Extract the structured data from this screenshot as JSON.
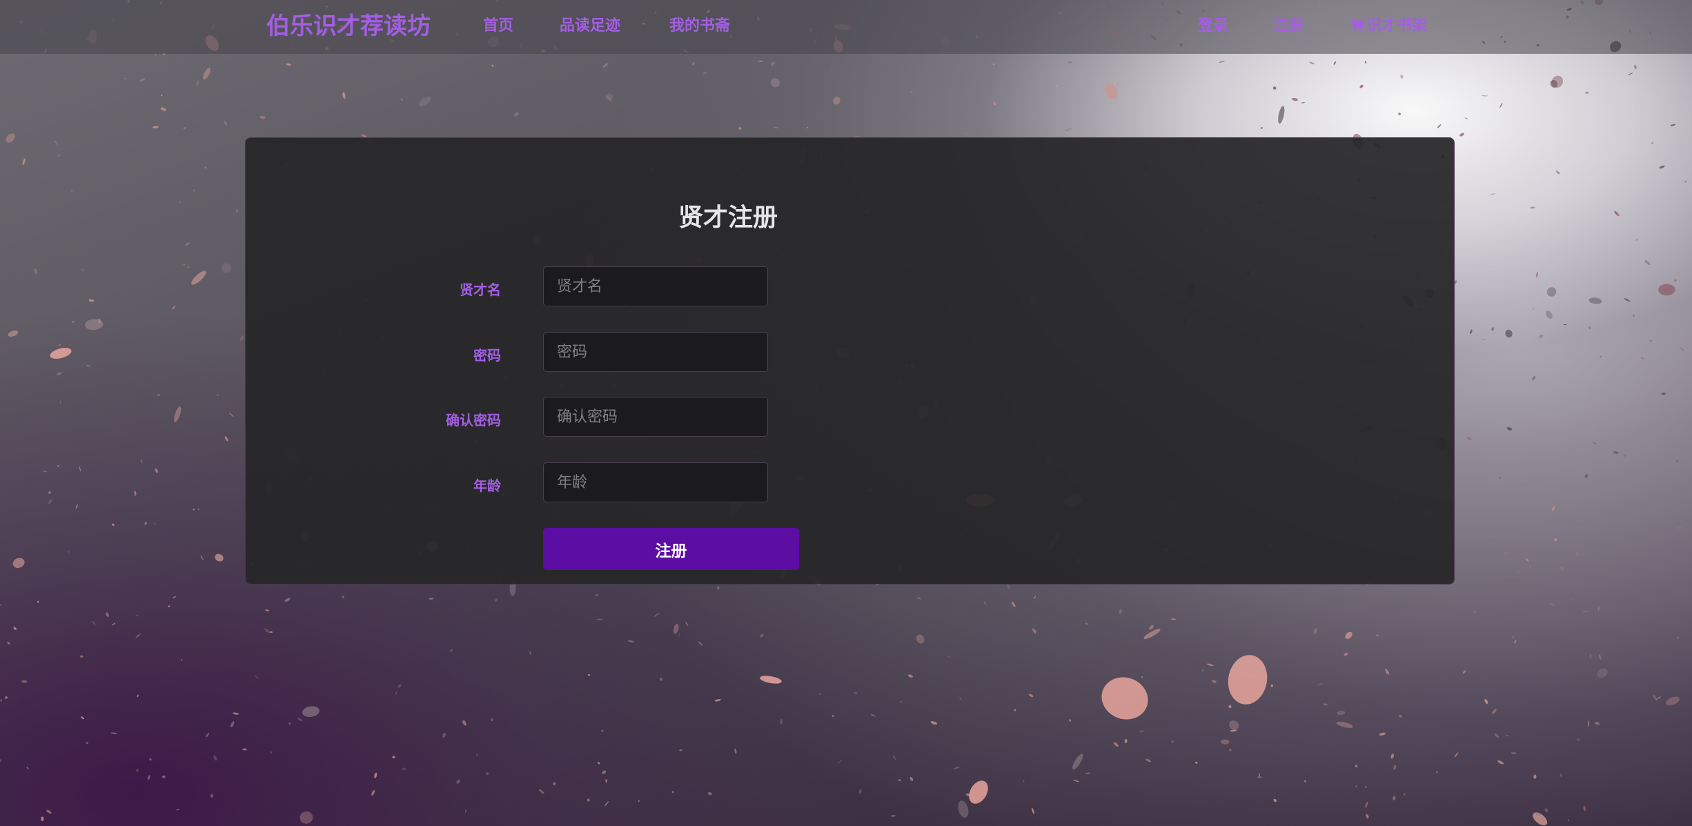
{
  "navbar": {
    "brand": "伯乐识才荐读坊",
    "links": [
      {
        "label": "首页"
      },
      {
        "label": "品读足迹"
      },
      {
        "label": "我的书斋"
      }
    ],
    "right_links": [
      {
        "label": "登录"
      },
      {
        "label": "注册"
      },
      {
        "label": "识才书架",
        "icon": "cart-icon"
      }
    ]
  },
  "form": {
    "title": "贤才注册",
    "fields": [
      {
        "label": "贤才名",
        "placeholder": "贤才名",
        "value": ""
      },
      {
        "label": "密码",
        "placeholder": "密码",
        "value": ""
      },
      {
        "label": "确认密码",
        "placeholder": "确认密码",
        "value": ""
      },
      {
        "label": "年龄",
        "placeholder": "年龄",
        "value": ""
      }
    ],
    "submit_label": "注册"
  },
  "colors": {
    "accent": "#a45ee5",
    "button": "#5c0ea4",
    "card_bg": "#262628",
    "input_bg": "#1b1b1d"
  }
}
